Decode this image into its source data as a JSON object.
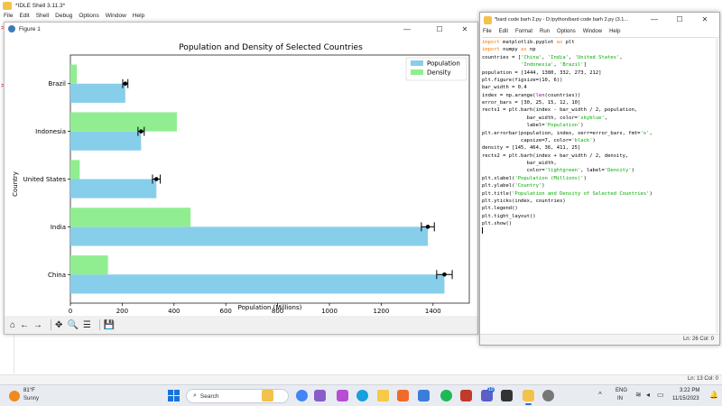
{
  "idle_shell": {
    "title": "*IDLE Shell 3.11.3*",
    "menu": [
      "File",
      "Edit",
      "Shell",
      "Debug",
      "Options",
      "Window",
      "Help"
    ],
    "prompt_symbol": ">",
    "status": "Ln: 13  Col: 0"
  },
  "figure_window": {
    "title": "Figure 1",
    "controls": {
      "minimize": "—",
      "maximize": "☐",
      "close": "✕"
    }
  },
  "chart_data": {
    "type": "bar",
    "orientation": "horizontal",
    "title": "Population and Density of Selected Countries",
    "xlabel": "Population (Millions)",
    "ylabel": "Country",
    "categories": [
      "China",
      "India",
      "United States",
      "Indonesia",
      "Brazil"
    ],
    "series": [
      {
        "name": "Population",
        "values": [
          1444,
          1380,
          332,
          273,
          212
        ],
        "errors": [
          30,
          25,
          15,
          12,
          10
        ],
        "color": "#87ceeb"
      },
      {
        "name": "Density",
        "values": [
          145,
          464,
          36,
          411,
          25
        ],
        "color": "#90ee90"
      }
    ],
    "xlim": [
      0,
      1540
    ],
    "xticks": [
      0,
      200,
      400,
      600,
      800,
      1000,
      1200,
      1400
    ],
    "error_color": "#000000",
    "legend_position": "top-right",
    "grid": false
  },
  "figure_toolbar": [
    "home-icon",
    "back-icon",
    "forward-icon",
    "pan-icon",
    "zoom-icon",
    "configure-icon",
    "save-icon"
  ],
  "editor": {
    "title": "*bard code barh 2.py - D:/python/bard code barh 2.py (3.1...",
    "controls": {
      "minimize": "—",
      "maximize": "☐",
      "close": "✕"
    },
    "menu": [
      "File",
      "Edit",
      "Format",
      "Run",
      "Options",
      "Window",
      "Help"
    ],
    "code_lines": [
      "import matplotlib.pyplot as plt",
      "import numpy as np",
      "countries = ['China', 'India', 'United States',",
      "             'Indonesia', 'Brazil']",
      "population = [1444, 1380, 332, 273, 212]",
      "plt.figure(figsize=(10, 6))",
      "bar_width = 0.4",
      "index = np.arange(len(countries))",
      "error_bars = [30, 25, 15, 12, 10]",
      "rects1 = plt.barh(index - bar_width / 2, population,",
      "               bar_width, color='skyblue',",
      "               label='Population')",
      "plt.errorbar(population, index, xerr=error_bars, fmt='o',",
      "             capsize=7, color='black')",
      "density = [145, 464, 36, 411, 25]",
      "rects2 = plt.barh(index + bar_width / 2, density,",
      "               bar_width,",
      "               color='lightgreen', label='Density')",
      "plt.xlabel('Population (Millions)')",
      "plt.ylabel('Country')",
      "plt.title('Population and Density of Selected Countries')",
      "plt.yticks(index, countries)",
      "plt.legend()",
      "plt.tight_layout()",
      "plt.show()",
      ""
    ],
    "status": "Ln: 26  Col: 0"
  },
  "taskbar": {
    "weather_temp": "81°F",
    "weather_condition": "Sunny",
    "search_placeholder": "Search",
    "apps": [
      "file-explorer",
      "chrome",
      "edge",
      "folder",
      "brave",
      "windows-security",
      "spotify",
      "pdf-reader",
      "teams",
      "python-idle",
      "settings"
    ],
    "badge_count": "10",
    "language_line1": "ENG",
    "language_line2": "IN",
    "time": "3:22 PM",
    "date": "11/15/2023"
  }
}
